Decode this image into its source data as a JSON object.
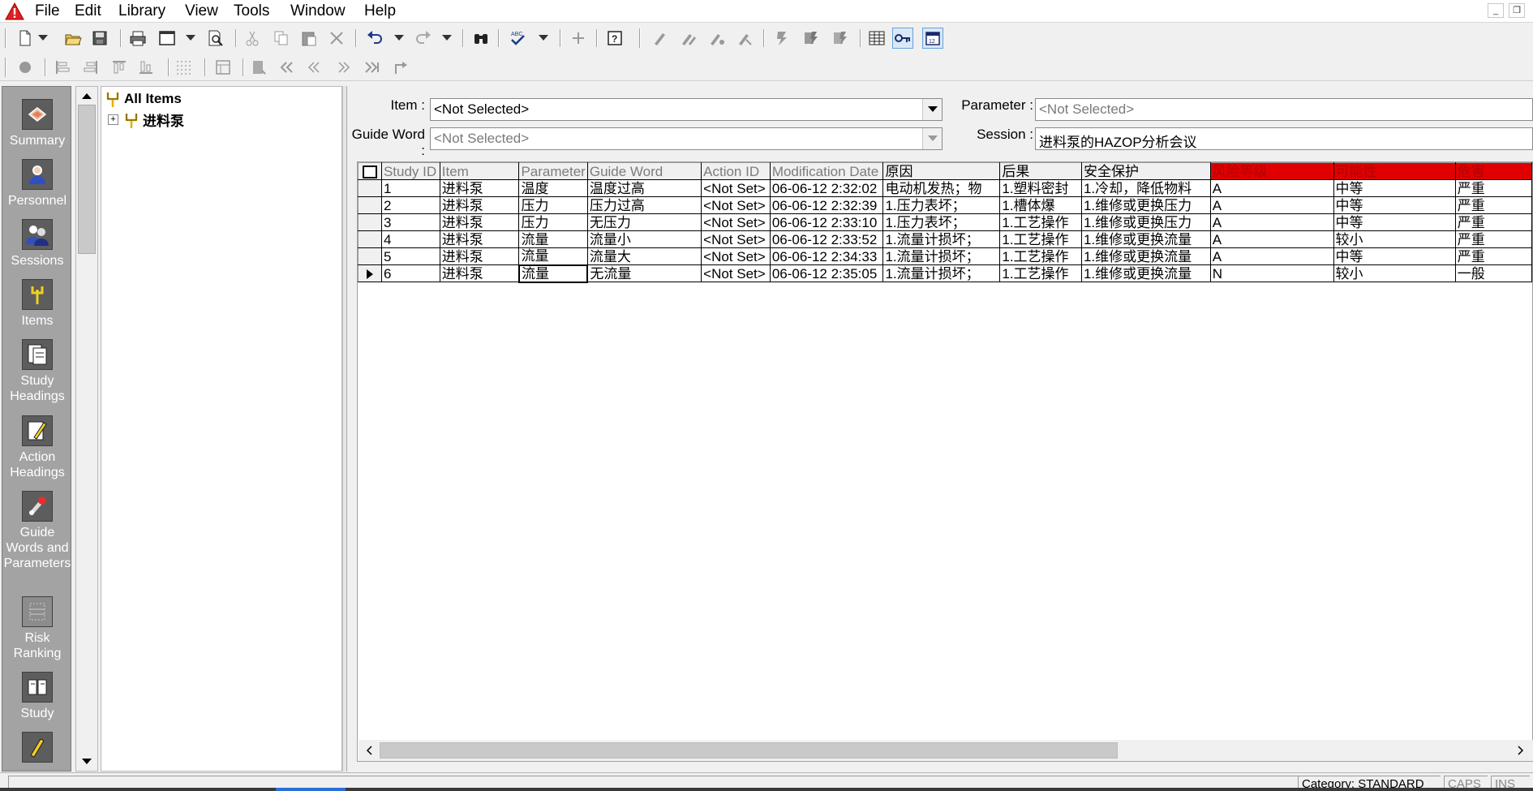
{
  "menu": [
    "File",
    "Edit",
    "Library",
    "View",
    "Tools",
    "Window",
    "Help"
  ],
  "window_controls": {
    "minimize": "_",
    "restore": "❐"
  },
  "nav": [
    {
      "label": "Summary"
    },
    {
      "label": "Personnel"
    },
    {
      "label": "Sessions"
    },
    {
      "label": "Items"
    },
    {
      "label": "Study Headings"
    },
    {
      "label": "Action Headings"
    },
    {
      "label": "Guide Words and Parameters"
    },
    {
      "label": "Risk Ranking"
    },
    {
      "label": "Study"
    }
  ],
  "tree": {
    "root": "All Items",
    "child": "进料泵",
    "expander": "+"
  },
  "filters": {
    "item_label": "Item :",
    "item_value": "<Not Selected>",
    "guide_word_label": "Guide Word :",
    "guide_word_value": "<Not Selected>",
    "parameter_label": "Parameter :",
    "parameter_value": "<Not Selected>",
    "session_label": "Session :",
    "session_value": "进料泵的HAZOP分析会议"
  },
  "table": {
    "columns": [
      "Study ID",
      "Item",
      "Parameter",
      "Guide Word",
      "Action ID",
      "Modification Date",
      "原因",
      "后果",
      "安全保护",
      "风险等级",
      "可能性",
      "危害"
    ],
    "rows": [
      [
        "1",
        "进料泵",
        "温度",
        "温度过高",
        "<Not Set>",
        "06-06-12 2:32:02",
        "电动机发热；物",
        "1.塑料密封",
        "1.冷却，降低物料",
        "A",
        "中等",
        "严重"
      ],
      [
        "2",
        "进料泵",
        "压力",
        "压力过高",
        "<Not Set>",
        "06-06-12 2:32:39",
        "1.压力表坏；",
        "1.槽体爆",
        "1.维修或更换压力",
        "A",
        "中等",
        "严重"
      ],
      [
        "3",
        "进料泵",
        "压力",
        "无压力",
        "<Not Set>",
        "06-06-12 2:33:10",
        "1.压力表坏；",
        "1.工艺操作",
        "1.维修或更换压力",
        "A",
        "中等",
        "严重"
      ],
      [
        "4",
        "进料泵",
        "流量",
        "流量小",
        "<Not Set>",
        "06-06-12 2:33:52",
        "1.流量计损坏；",
        "1.工艺操作",
        "1.维修或更换流量",
        "A",
        "较小",
        "严重"
      ],
      [
        "5",
        "进料泵",
        "流量",
        "流量大",
        "<Not Set>",
        "06-06-12 2:34:33",
        "1.流量计损坏；",
        "1.工艺操作",
        "1.维修或更换流量",
        "A",
        "中等",
        "严重"
      ],
      [
        "6",
        "进料泵",
        "流量",
        "无流量",
        "<Not Set>",
        "06-06-12 2:35:05",
        "1.流量计损坏；",
        "1.工艺操作",
        "1.维修或更换流量",
        "N",
        "较小",
        "一般"
      ]
    ],
    "current_row": 5
  },
  "status": {
    "category": "Category: STANDARD",
    "caps": "CAPS",
    "ins": "INS"
  },
  "colors": {
    "header_highlight": "#e00000",
    "nav_background": "#a3a3a3"
  }
}
